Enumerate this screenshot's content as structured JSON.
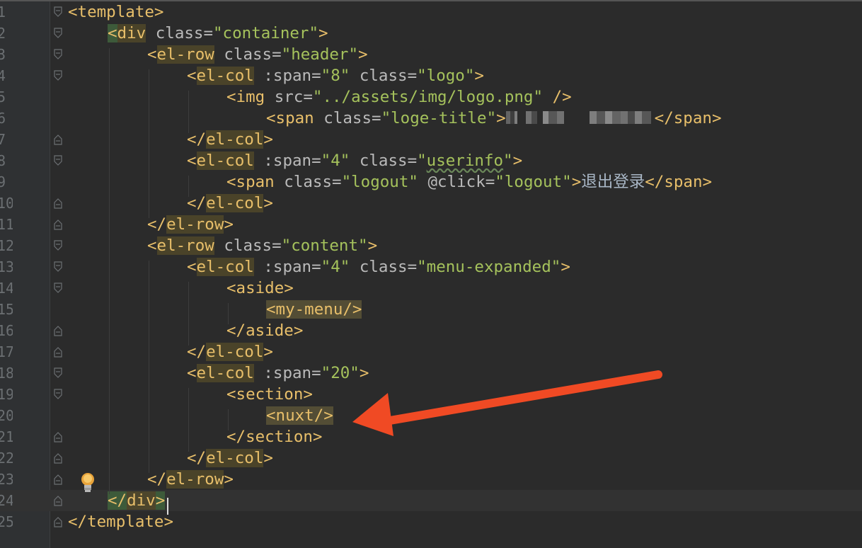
{
  "editor": {
    "lines": [
      {
        "num": "1",
        "parts": [
          [
            "p",
            "<"
          ],
          [
            "t",
            "template"
          ],
          [
            "p",
            ">"
          ]
        ]
      },
      {
        "num": "2",
        "parts": [
          [
            "p",
            "<"
          ],
          [
            "t",
            "div"
          ],
          [
            "a",
            " class="
          ],
          [
            "s",
            "\"container\""
          ],
          [
            "p",
            ">"
          ]
        ]
      },
      {
        "num": "3",
        "parts": [
          [
            "p",
            "<"
          ],
          [
            "t",
            "el-row"
          ],
          [
            "a",
            " class="
          ],
          [
            "s",
            "\"header\""
          ],
          [
            "p",
            ">"
          ]
        ]
      },
      {
        "num": "4",
        "parts": [
          [
            "p",
            "<"
          ],
          [
            "t",
            "el-col"
          ],
          [
            "a",
            " :span="
          ],
          [
            "s",
            "\"8\""
          ],
          [
            "a",
            " class="
          ],
          [
            "s",
            "\"logo\""
          ],
          [
            "p",
            ">"
          ]
        ]
      },
      {
        "num": "5",
        "parts": [
          [
            "p",
            "<"
          ],
          [
            "t",
            "img"
          ],
          [
            "a",
            " src="
          ],
          [
            "s",
            "\"../assets/img/logo.png\""
          ],
          [
            "p",
            " />"
          ]
        ]
      },
      {
        "num": "6",
        "parts": [
          [
            "p",
            "<"
          ],
          [
            "t",
            "span"
          ],
          [
            "a",
            " class="
          ],
          [
            "s",
            "\"loge-title\""
          ],
          [
            "p",
            ">"
          ],
          [
            "blur",
            ""
          ],
          [
            "p",
            "</"
          ],
          [
            "t",
            "span"
          ],
          [
            "p",
            ">"
          ]
        ]
      },
      {
        "num": "7",
        "parts": [
          [
            "p",
            "</"
          ],
          [
            "t",
            "el-col"
          ],
          [
            "p",
            ">"
          ]
        ]
      },
      {
        "num": "8",
        "parts": [
          [
            "p",
            "<"
          ],
          [
            "t",
            "el-col"
          ],
          [
            "a",
            " :span="
          ],
          [
            "s",
            "\"4\""
          ],
          [
            "a",
            " class="
          ],
          [
            "s",
            "\""
          ],
          [
            "sq",
            "userinfo"
          ],
          [
            "s",
            "\""
          ],
          [
            "p",
            ">"
          ]
        ]
      },
      {
        "num": "9",
        "parts": [
          [
            "p",
            "<"
          ],
          [
            "t",
            "span"
          ],
          [
            "a",
            " class="
          ],
          [
            "s",
            "\"logout\""
          ],
          [
            "a",
            " @click="
          ],
          [
            "s",
            "\"logout\""
          ],
          [
            "p",
            ">"
          ],
          [
            "txt",
            "退出登录"
          ],
          [
            "p",
            "</"
          ],
          [
            "t",
            "span"
          ],
          [
            "p",
            ">"
          ]
        ]
      },
      {
        "num": "10",
        "parts": [
          [
            "p",
            "</"
          ],
          [
            "t",
            "el-col"
          ],
          [
            "p",
            ">"
          ]
        ]
      },
      {
        "num": "11",
        "parts": [
          [
            "p",
            "</"
          ],
          [
            "t",
            "el-row"
          ],
          [
            "p",
            ">"
          ]
        ]
      },
      {
        "num": "12",
        "parts": [
          [
            "p",
            "<"
          ],
          [
            "t",
            "el-row"
          ],
          [
            "a",
            " class="
          ],
          [
            "s",
            "\"content\""
          ],
          [
            "p",
            ">"
          ]
        ]
      },
      {
        "num": "13",
        "parts": [
          [
            "p",
            "<"
          ],
          [
            "t",
            "el-col"
          ],
          [
            "a",
            " :span="
          ],
          [
            "s",
            "\"4\""
          ],
          [
            "a",
            " class="
          ],
          [
            "s",
            "\"menu-expanded\""
          ],
          [
            "p",
            ">"
          ]
        ]
      },
      {
        "num": "14",
        "parts": [
          [
            "p",
            "<"
          ],
          [
            "t",
            "aside"
          ],
          [
            "p",
            ">"
          ]
        ]
      },
      {
        "num": "15",
        "parts": [
          [
            "p",
            "<"
          ],
          [
            "t",
            "my-menu"
          ],
          [
            "p",
            "/>"
          ]
        ]
      },
      {
        "num": "16",
        "parts": [
          [
            "p",
            "</"
          ],
          [
            "t",
            "aside"
          ],
          [
            "p",
            ">"
          ]
        ]
      },
      {
        "num": "17",
        "parts": [
          [
            "p",
            "</"
          ],
          [
            "t",
            "el-col"
          ],
          [
            "p",
            ">"
          ]
        ]
      },
      {
        "num": "18",
        "parts": [
          [
            "p",
            "<"
          ],
          [
            "t",
            "el-col"
          ],
          [
            "a",
            " :span="
          ],
          [
            "s",
            "\"20\""
          ],
          [
            "p",
            ">"
          ]
        ]
      },
      {
        "num": "19",
        "parts": [
          [
            "p",
            "<"
          ],
          [
            "t",
            "section"
          ],
          [
            "p",
            ">"
          ]
        ]
      },
      {
        "num": "20",
        "parts": [
          [
            "p",
            "<"
          ],
          [
            "t",
            "nuxt"
          ],
          [
            "p",
            "/>"
          ]
        ]
      },
      {
        "num": "21",
        "parts": [
          [
            "p",
            "</"
          ],
          [
            "t",
            "section"
          ],
          [
            "p",
            ">"
          ]
        ]
      },
      {
        "num": "22",
        "parts": [
          [
            "p",
            "</"
          ],
          [
            "t",
            "el-col"
          ],
          [
            "p",
            ">"
          ]
        ]
      },
      {
        "num": "23",
        "parts": [
          [
            "p",
            "</"
          ],
          [
            "t",
            "el-row"
          ],
          [
            "p",
            ">"
          ]
        ]
      },
      {
        "num": "24",
        "parts": [
          [
            "p",
            "</"
          ],
          [
            "t",
            "div"
          ],
          [
            "p",
            ">"
          ]
        ]
      },
      {
        "num": "25",
        "parts": [
          [
            "p",
            "</"
          ],
          [
            "t",
            "template"
          ],
          [
            "p",
            ">"
          ]
        ]
      }
    ]
  },
  "colors": {
    "background": "#2b2b2b",
    "tag": "#e8bf6a",
    "attribute": "#bababa",
    "string": "#a5c25c",
    "arrow": "#f04a24"
  },
  "icons": {
    "bulb": "lightbulb-icon",
    "fold": "fold-marker-icon",
    "arrow": "annotation-arrow-icon"
  }
}
